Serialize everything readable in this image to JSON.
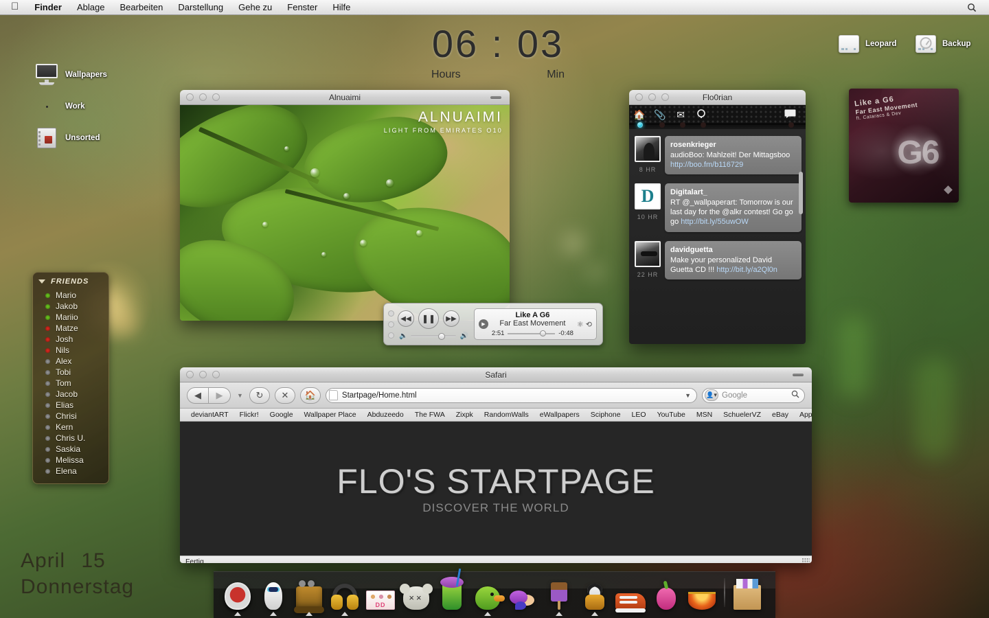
{
  "menubar": {
    "apple_icon": "apple-icon",
    "items": [
      {
        "label": "Finder",
        "bold": true
      },
      {
        "label": "Ablage",
        "bold": false
      },
      {
        "label": "Bearbeiten",
        "bold": false
      },
      {
        "label": "Darstellung",
        "bold": false
      },
      {
        "label": "Gehe zu",
        "bold": false
      },
      {
        "label": "Fenster",
        "bold": false
      },
      {
        "label": "Hilfe",
        "bold": false
      }
    ],
    "spotlight_icon": "search-icon"
  },
  "clock": {
    "hours": "06",
    "separator": ":",
    "minutes": "03",
    "hours_label": "Hours",
    "minutes_label": "Min"
  },
  "date_widget": {
    "month": "April",
    "day": "15",
    "weekday": "Donnerstag"
  },
  "desktop_icons": [
    {
      "label": "Wallpapers",
      "icon": "imac-icon"
    },
    {
      "label": "Work",
      "icon": "vinyl-record-icon"
    },
    {
      "label": "Unsorted",
      "icon": "safe-icon"
    }
  ],
  "drives": [
    {
      "label": "Leopard",
      "icon": "hard-drive-icon"
    },
    {
      "label": "Backup",
      "icon": "time-machine-drive-icon"
    }
  ],
  "friends_widget": {
    "title": "FRIENDS",
    "disclosure_icon": "triangle-down-icon",
    "colors": {
      "online": "#6fcc20",
      "busy": "#e02b20",
      "offline": "#9b9b9b"
    },
    "items": [
      {
        "name": "Mario",
        "status": "online"
      },
      {
        "name": "Jakob",
        "status": "online"
      },
      {
        "name": "Mariio",
        "status": "online"
      },
      {
        "name": "Matze",
        "status": "busy"
      },
      {
        "name": "Josh",
        "status": "busy"
      },
      {
        "name": "Nils",
        "status": "busy"
      },
      {
        "name": "Alex",
        "status": "offline"
      },
      {
        "name": "Tobi",
        "status": "offline"
      },
      {
        "name": "Tom",
        "status": "offline"
      },
      {
        "name": "Jacob",
        "status": "offline"
      },
      {
        "name": "Elias",
        "status": "offline"
      },
      {
        "name": "Chrisi",
        "status": "offline"
      },
      {
        "name": "Kern",
        "status": "offline"
      },
      {
        "name": "Chris U.",
        "status": "offline"
      },
      {
        "name": "Saskia",
        "status": "offline"
      },
      {
        "name": "Melissa",
        "status": "offline"
      },
      {
        "name": "Elena",
        "status": "offline"
      }
    ]
  },
  "photo_window": {
    "title": "Alnuaimi",
    "caption_title": "ALNUAIMI",
    "caption_sub": "LIGHT FROM EMIRATES O10"
  },
  "twitter_window": {
    "title": "Flo0rian",
    "toolbar_icons": [
      "home-icon",
      "paperclip-icon",
      "envelope-icon",
      "search-icon",
      "chat-bubble-icon"
    ],
    "tweets": [
      {
        "user": "rosenkrieger",
        "text": "audioBoo: Mahlzeit! Der Mittagsboo ",
        "link": "http://boo.fm/b116729",
        "age": "8 HR",
        "avatar": "avatar-rosenkrieger"
      },
      {
        "user": "Digitalart_",
        "text": "RT @_wallpaperart: Tomorrow is our last day for the @alkr contest! Go go go ",
        "link": "http://bit.ly/55uwOW",
        "age": "10 HR",
        "avatar": "avatar-digitalart"
      },
      {
        "user": "davidguetta",
        "text": "Make your personalized David Guetta CD !!! ",
        "link": "http://bit.ly/a2Ql0n",
        "age": "22 HR",
        "avatar": "avatar-davidguetta"
      }
    ]
  },
  "player": {
    "prev_icon": "rewind-icon",
    "play_pause_icon": "pause-icon",
    "next_icon": "fast-forward-icon",
    "volume_low_icon": "volume-low-icon",
    "volume_high_icon": "volume-high-icon",
    "track": "Like A G6",
    "artist": "Far East Movement",
    "elapsed": "2:51",
    "remaining": "-0:48",
    "shuffle_icon": "shuffle-icon",
    "repeat_icon": "repeat-icon"
  },
  "album_art": {
    "title": "Like a G6",
    "artist": "Far East Movement",
    "feature": "ft. Cataracs & Dev",
    "big_text": "G6"
  },
  "safari": {
    "title": "Safari",
    "back_icon": "back-arrow-icon",
    "forward_icon": "forward-arrow-icon",
    "reload_icon": "reload-icon",
    "stop_icon": "stop-icon",
    "home_icon": "home-icon",
    "url": "Startpage/Home.html",
    "search_placeholder": "Google",
    "search_engine_icon": "search-engine-icon",
    "search_icon": "magnifier-icon",
    "bookmarks": [
      "deviantART",
      "Flickr!",
      "Google",
      "Wallpaper Place",
      "Abduzeedo",
      "The FWA",
      "Zixpk",
      "RandomWalls",
      "eWallpapers",
      "Sciphone",
      "LEO",
      "YouTube",
      "MSN",
      "SchuelerVZ",
      "eBay",
      "Apple"
    ],
    "page": {
      "heading": "FLO'S STARTPAGE",
      "subheading": "DISCOVER THE WORLD"
    },
    "status": "Fertig"
  },
  "dock": {
    "items": [
      {
        "name": "finder-chair",
        "running": true
      },
      {
        "name": "eve-robot",
        "running": true
      },
      {
        "name": "wall-e-robot",
        "running": true
      },
      {
        "name": "headphones",
        "running": true
      },
      {
        "name": "dunkin-donuts",
        "running": false
      },
      {
        "name": "kaws-bear",
        "running": false
      },
      {
        "name": "slush-cup",
        "running": false
      },
      {
        "name": "green-duck",
        "running": true
      },
      {
        "name": "purple-cloud",
        "running": false
      },
      {
        "name": "ice-cream-bar",
        "running": true
      },
      {
        "name": "kung-fu-panda",
        "running": true
      },
      {
        "name": "sneaker",
        "running": false
      },
      {
        "name": "pink-pepper",
        "running": false
      },
      {
        "name": "red-bowl",
        "running": false
      },
      {
        "name": "file-box",
        "running": false
      }
    ]
  }
}
